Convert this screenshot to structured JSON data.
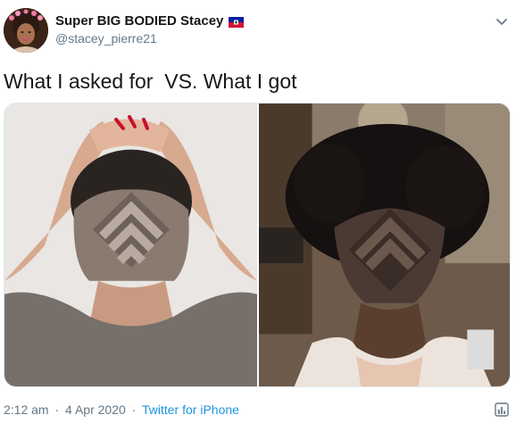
{
  "author": {
    "display_name": "Super BIG BODIED Stacey",
    "handle": "@stacey_pierre21",
    "flag_icon": "haiti-flag-icon",
    "avatar_icon": "profile-avatar"
  },
  "tweet": {
    "text": "What I asked for  VS. What I got"
  },
  "media": {
    "left_image": "photo-asked-for-undercut",
    "right_image": "photo-got-haircut"
  },
  "meta": {
    "time": "2:12 am",
    "separator": "·",
    "date": "4 Apr 2020",
    "source": "Twitter for iPhone"
  },
  "colors": {
    "text_primary": "#14171a",
    "text_secondary": "#657786",
    "link": "#1b95e0",
    "border": "#e1e8ed"
  },
  "icons": {
    "menu": "chevron-down-icon",
    "analytics": "analytics-icon"
  }
}
